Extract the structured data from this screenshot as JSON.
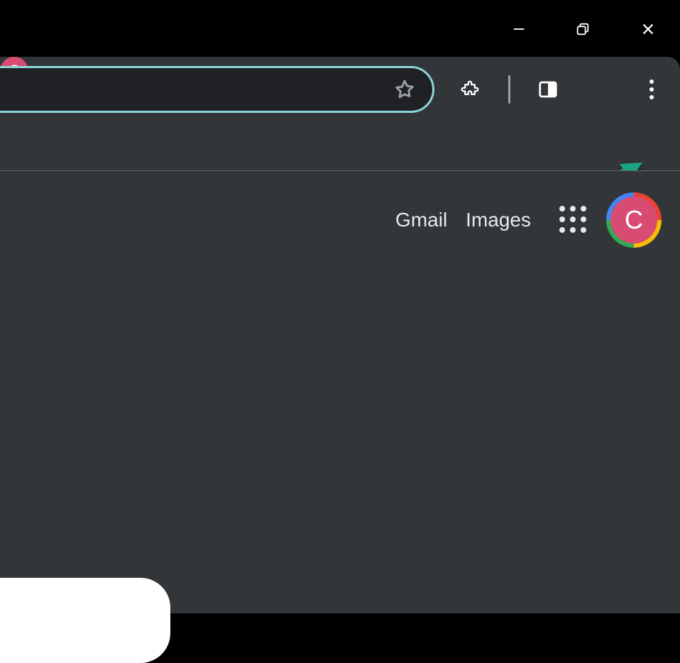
{
  "window_controls": {
    "minimize": "minimize",
    "maximize": "maximize",
    "close": "close"
  },
  "toolbar": {
    "omnibox_value": "",
    "omnibox_placeholder": "",
    "bookmark_label": "bookmark",
    "extensions_label": "extensions",
    "side_panel_label": "side-panel",
    "profile_letter": "C",
    "menu_label": "customize-and-control"
  },
  "content": {
    "links": {
      "gmail": "Gmail",
      "images": "Images"
    },
    "apps_label": "google-apps",
    "account_letter": "C"
  },
  "annotation": {
    "arrow_color": "#1aa583"
  }
}
